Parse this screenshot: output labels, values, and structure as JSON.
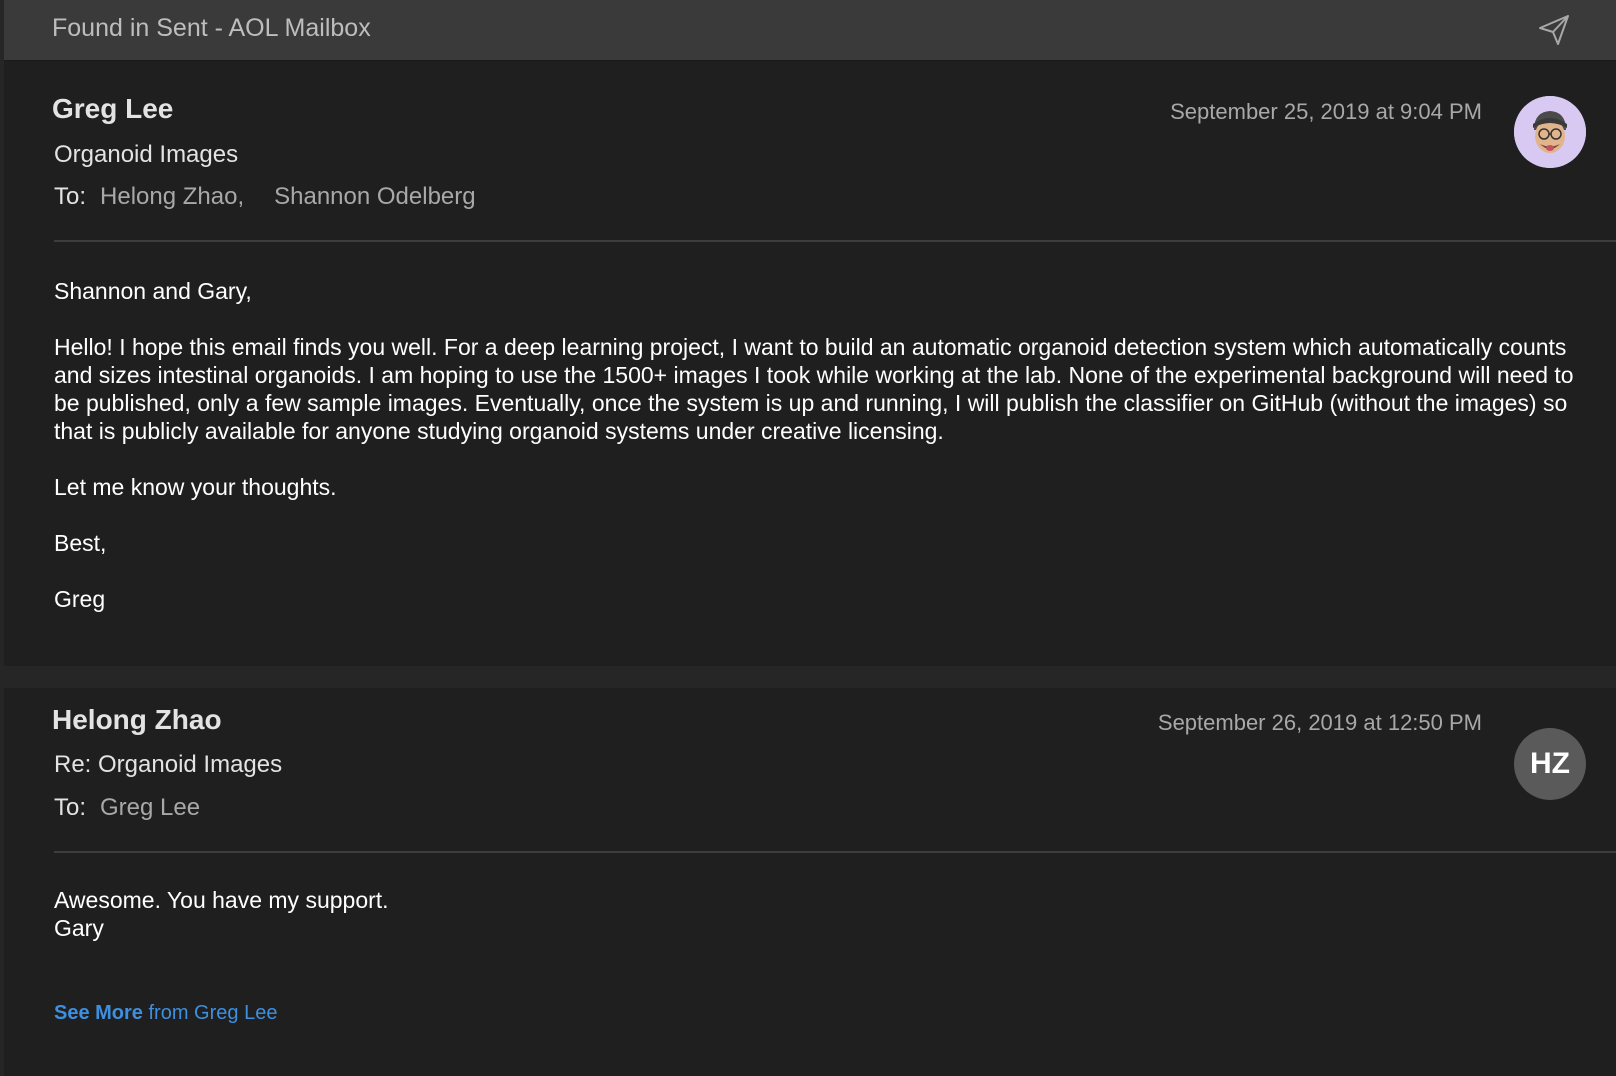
{
  "window": {
    "title": "Found in Sent - AOL Mailbox"
  },
  "messages": [
    {
      "from": "Greg Lee",
      "subject": "Organoid Images",
      "to_label": "To:",
      "recipients": [
        "Helong Zhao,",
        "Shannon Odelberg"
      ],
      "date": "September 25, 2019 at 9:04 PM",
      "body": {
        "greeting": "Shannon and Gary,",
        "paragraph": "Hello! I hope this email finds you well. For a deep learning project, I want to build an automatic organoid detection system which automatically counts and sizes intestinal organoids. I am hoping to use the 1500+ images I took while working at the lab. None of the experimental background will need to be published, only a few sample images. Eventually, once the system is up and running, I will publish the classifier on GitHub (without the images) so that is publicly available for anyone studying organoid systems under creative licensing.",
        "closing_line": "Let me know your thoughts.",
        "signoff": "Best,",
        "signature": "Greg"
      }
    },
    {
      "from": "Helong Zhao",
      "subject": "Re: Organoid Images",
      "to_label": "To:",
      "recipients": [
        "Greg Lee"
      ],
      "date": "September 26, 2019 at 12:50 PM",
      "avatar_initials": "HZ",
      "body": {
        "line1": "Awesome. You have my support.",
        "line2": "Gary"
      },
      "see_more": {
        "strong": "See More",
        "rest": " from Greg Lee"
      }
    }
  ]
}
